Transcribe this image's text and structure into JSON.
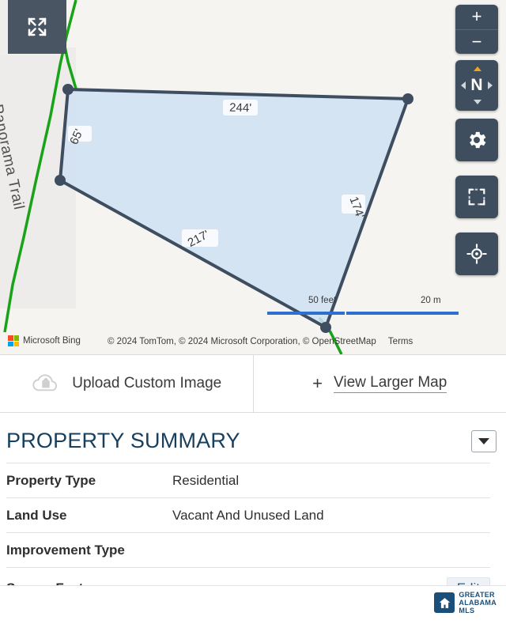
{
  "map": {
    "road_label": "Panorama Trail",
    "parcel_dimensions": [
      {
        "id": "top",
        "label": "244'"
      },
      {
        "id": "left-upper",
        "label": "65'"
      },
      {
        "id": "right",
        "label": "174'"
      },
      {
        "id": "bottom-left",
        "label": "217'"
      }
    ],
    "scale": {
      "feet_label": "50 feet",
      "meters_label": "20 m"
    },
    "attribution": {
      "provider": "Microsoft Bing",
      "copyright": "© 2024 TomTom,  © 2024 Microsoft Corporation,",
      "osm": "© OpenStreetMap",
      "terms": "Terms"
    },
    "controls": {
      "expand": "expand-icon",
      "zoom_in": "+",
      "zoom_out": "−",
      "compass": "N",
      "settings": "gear-icon",
      "measure": "select-area-icon",
      "locate": "locate-icon"
    }
  },
  "actions": {
    "upload_label": "Upload Custom Image",
    "view_larger_plus": "+",
    "view_larger_label": "View Larger Map"
  },
  "summary": {
    "title": "PROPERTY SUMMARY",
    "rows": [
      {
        "label": "Property Type",
        "value": "Residential",
        "action": ""
      },
      {
        "label": "Land Use",
        "value": "Vacant And Unused Land",
        "action": ""
      },
      {
        "label": "Improvement Type",
        "value": "",
        "action": ""
      },
      {
        "label": "Square Feet",
        "value": "",
        "action": "Edit"
      }
    ]
  },
  "footer": {
    "logo_line1": "GREATER",
    "logo_line2": "ALABAMA",
    "logo_line3": "MLS"
  },
  "colors": {
    "parcel_fill": "#cfe0f2",
    "parcel_stroke": "#3e4e60",
    "road_green": "#19a319",
    "control_bg": "#3f4e5e",
    "title_blue": "#16405e",
    "scale_blue": "#2f6fd0"
  }
}
